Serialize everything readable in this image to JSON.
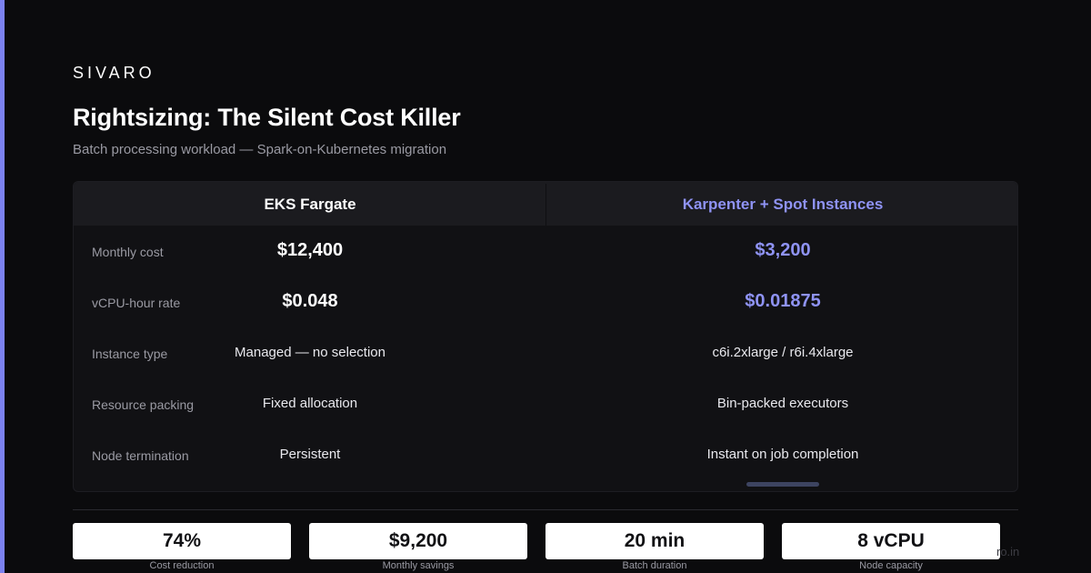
{
  "brand": "SIVARO",
  "title": "Rightsizing: The Silent Cost Killer",
  "subtitle": "Batch processing workload — Spark-on-Kubernetes migration",
  "comparison": {
    "left_header": "EKS Fargate",
    "right_header": "Karpenter + Spot Instances",
    "rows": [
      {
        "label": "Monthly cost",
        "left": "$12,400",
        "right": "$3,200"
      },
      {
        "label": "vCPU-hour rate",
        "left": "$0.048",
        "right": "$0.01875"
      },
      {
        "label": "Instance type",
        "left": "Managed — no selection",
        "right": "c6i.2xlarge / r6i.4xlarge"
      },
      {
        "label": "Resource packing",
        "left": "Fixed allocation",
        "right": "Bin-packed executors"
      },
      {
        "label": "Node termination",
        "left": "Persistent",
        "right": "Instant on job completion"
      }
    ]
  },
  "stats": [
    {
      "value": "74%",
      "label": "Cost reduction"
    },
    {
      "value": "$9,200",
      "label": "Monthly savings"
    },
    {
      "value": "20 min",
      "label": "Batch duration"
    },
    {
      "value": "8 vCPU",
      "label": "Node capacity"
    }
  ],
  "footer_url": "ro.in",
  "colors": {
    "background": "#0b0b0d",
    "accent": "#7c82f0",
    "highlight_text": "#8f93f5",
    "panel": "#111114"
  }
}
